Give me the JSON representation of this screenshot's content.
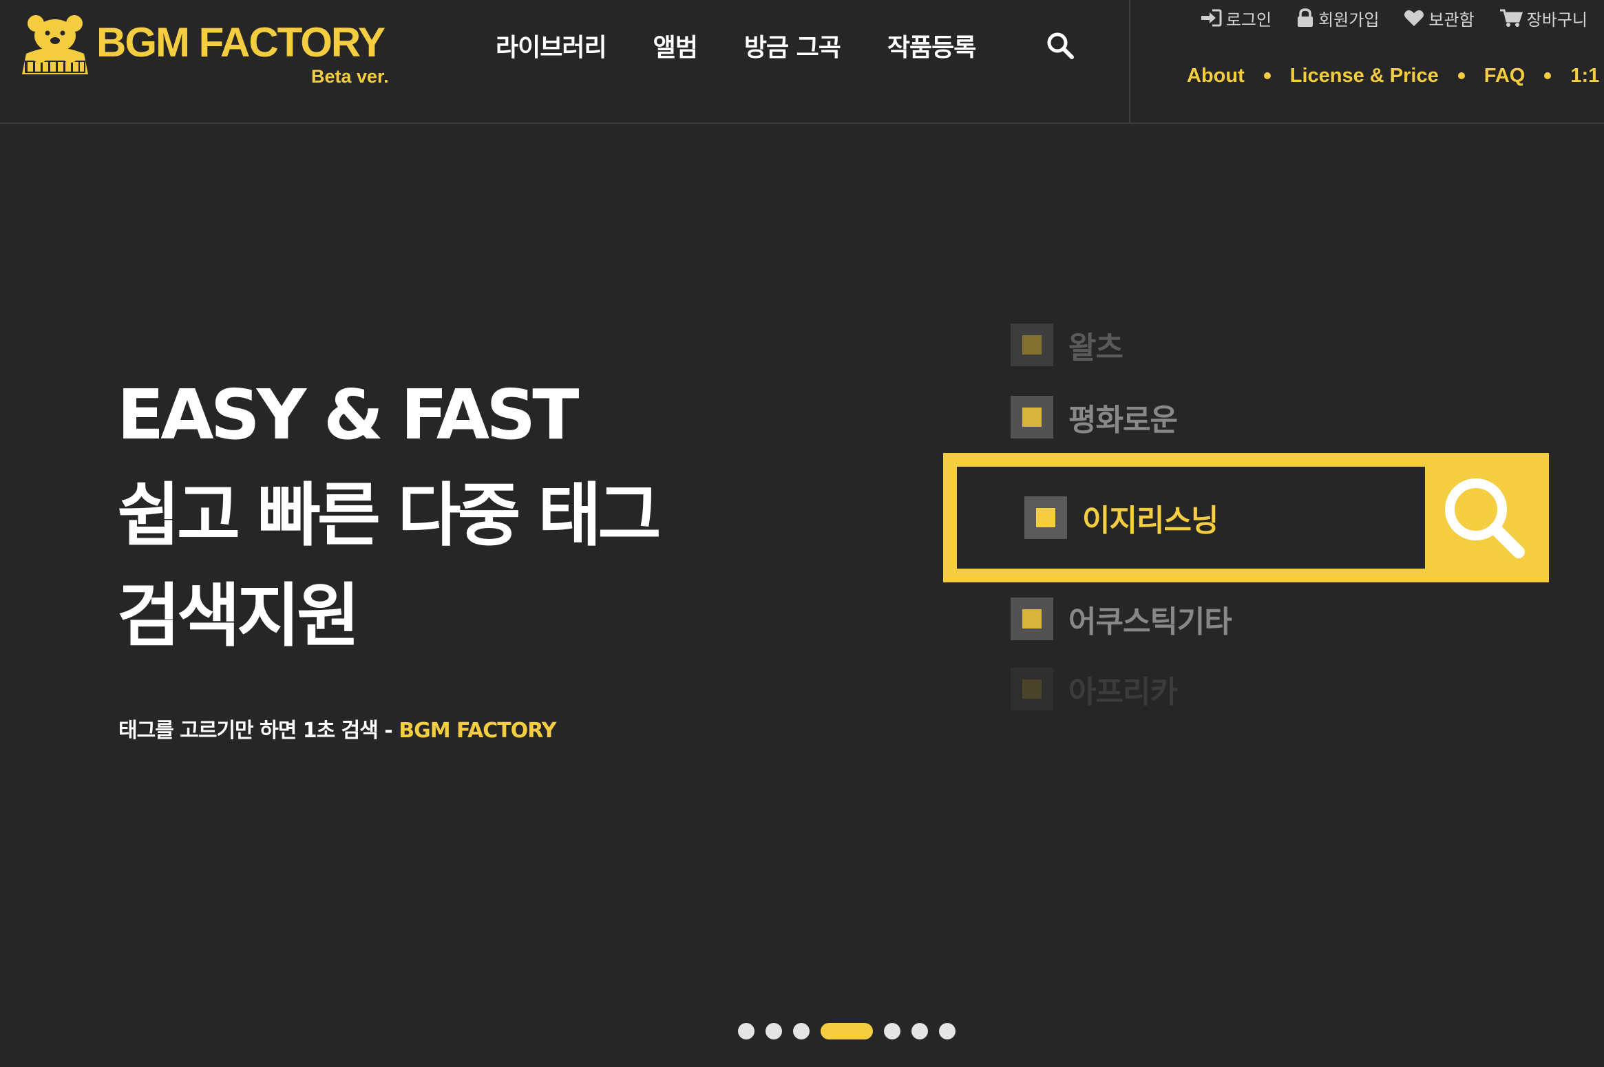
{
  "logo": {
    "name": "BGM FACTORY",
    "beta": "Beta ver.",
    "brand_color": "#f5cd40"
  },
  "main_nav": {
    "items": [
      {
        "label": "라이브러리"
      },
      {
        "label": "앨범"
      },
      {
        "label": "방금 그곡"
      },
      {
        "label": "작품등록"
      }
    ],
    "search_icon": "search-icon"
  },
  "utility_nav": {
    "items": [
      {
        "label": "로그인",
        "icon": "login-icon"
      },
      {
        "label": "회원가입",
        "icon": "lock-icon"
      },
      {
        "label": "보관함",
        "icon": "heart-icon"
      },
      {
        "label": "장바구니",
        "icon": "cart-icon"
      }
    ]
  },
  "info_nav": {
    "items": [
      {
        "label": "About"
      },
      {
        "label": "License & Price"
      },
      {
        "label": "FAQ"
      },
      {
        "label": "1:1"
      }
    ]
  },
  "hero": {
    "title_line1": "EASY & FAST",
    "title_line2": "쉽고 빠른 다중 태그",
    "title_line3": "검색지원",
    "subtitle": "태그를 고르기만 하면 1초 검색 - ",
    "subtitle_brand": "BGM FACTORY"
  },
  "tag_demo": {
    "tags": [
      "왈츠",
      "평화로운",
      "이지리스닝",
      "어쿠스틱기타",
      "아프리카"
    ],
    "selected_tag": "이지리스닝"
  },
  "slider": {
    "dot_count": 7,
    "active_index": 3
  },
  "colors": {
    "background": "#262626",
    "accent": "#f5cd40",
    "text": "#ffffff",
    "muted": "#9a9a9a"
  }
}
